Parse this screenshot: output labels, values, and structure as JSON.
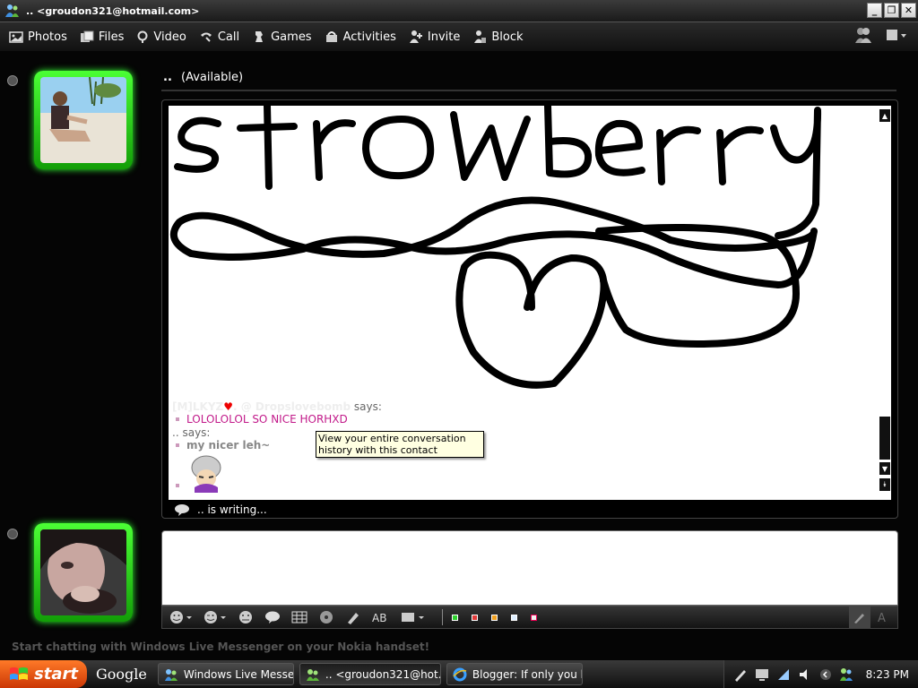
{
  "window": {
    "title": ".. <groudon321@hotmail.com>",
    "minimize": "_",
    "restore": "❐",
    "close": "✕"
  },
  "toolbar": {
    "items": [
      {
        "label": "Photos",
        "icon": "photos-icon"
      },
      {
        "label": "Files",
        "icon": "files-icon"
      },
      {
        "label": "Video",
        "icon": "video-icon"
      },
      {
        "label": "Call",
        "icon": "call-icon"
      },
      {
        "label": "Games",
        "icon": "games-icon"
      },
      {
        "label": "Activities",
        "icon": "activities-icon"
      },
      {
        "label": "Invite",
        "icon": "invite-icon"
      },
      {
        "label": "Block",
        "icon": "block-icon"
      }
    ]
  },
  "contact": {
    "name": "..",
    "status": "(Available)"
  },
  "conversation": {
    "drawing_text": "strawberry",
    "messages": [
      {
        "sender": "[M]LKYZ",
        "sender_suffix": ". @ Dropslovebomb",
        "says": "says:",
        "text": "LOLOLOLOL SO NICE HORHXD"
      },
      {
        "sender": "..",
        "says": "says:",
        "text": "my nicer leh~"
      }
    ],
    "tooltip": "View your entire conversation history with this contact",
    "writing_status": ".. is writing..."
  },
  "footer": {
    "nokia_text": "Start chatting with Windows Live Messenger on your Nokia handset!"
  },
  "taskbar": {
    "start": "start",
    "google": "Google",
    "tasks": [
      {
        "label": "Windows Live Messen...",
        "icon": "messenger-icon"
      },
      {
        "label": ".. <groudon321@hot...",
        "icon": "messenger-icon"
      },
      {
        "label": "Blogger: If only you k...",
        "icon": "ie-icon"
      }
    ],
    "clock": "8:23 PM"
  },
  "colors": {
    "accent_green": "#33dd22",
    "message_pink": "#c21a8a",
    "start_orange": "#e0520f"
  }
}
